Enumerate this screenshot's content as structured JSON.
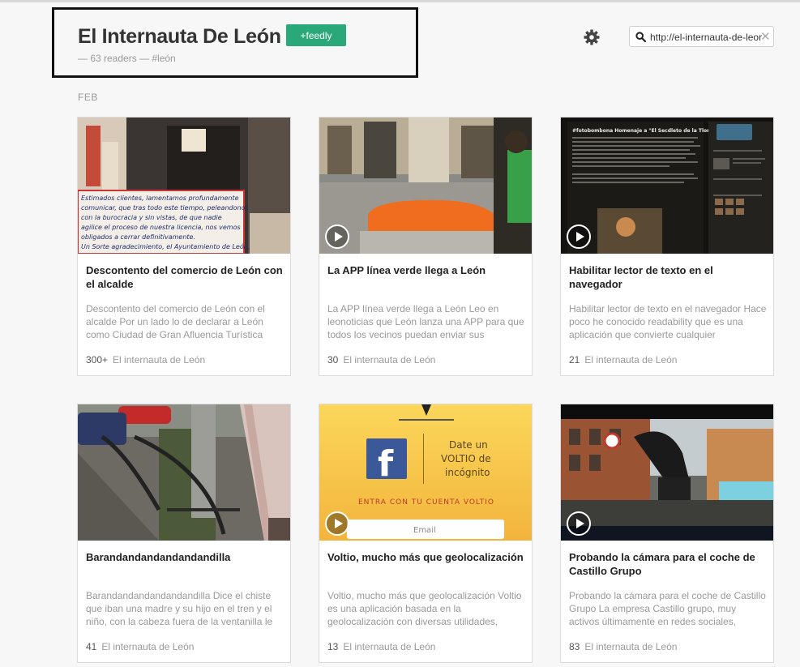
{
  "header": {
    "title": "El Internauta De León",
    "follow_label": "+feedly",
    "subline": "— 63 readers — #león"
  },
  "toolbar": {
    "settings_icon": "gear-icon",
    "search_value": "http://el-internauta-de-leon",
    "search_icon": "search-icon",
    "clear_icon": "close-icon"
  },
  "month_label": "FEB",
  "cards": [
    {
      "title": "Descontento del comercio de León con el alcalde",
      "summary": "Descontento del comercio de León con el alcalde Por un lado lo de declarar a León como Ciudad de Gran Afluencia Turística",
      "count": "300+",
      "source": "El internauta de León",
      "has_play": false
    },
    {
      "title": "La APP línea verde llega a León",
      "summary": "La APP línea verde llega a León Leo en leonoticias que León lanza una APP para que todos los vecinos puedan enviar sus",
      "count": "30",
      "source": "El internauta de León",
      "has_play": true
    },
    {
      "title": "Habilitar lector de texto en el navegador",
      "summary": "Habilitar lector de texto en el navegador Hace poco he conocido readability que es una aplicación que convierte cualquier",
      "count": "21",
      "source": "El internauta de León",
      "has_play": true
    },
    {
      "title": "Barandandandandandandilla",
      "summary": "Barandandandandandandilla Dice el chiste que iban una madre y su hijo en el tren y el niño, con la cabeza fuera de la ventanilla le",
      "count": "41",
      "source": "El internauta de León",
      "has_play": false
    },
    {
      "title": "Voltio, mucho más que geolocalización",
      "summary": "Voltio, mucho más que geolocalización Voltio es una aplicación basada en la geolocalización con diversas utilidades,",
      "count": "13",
      "source": "El internauta de León",
      "has_play": true
    },
    {
      "title": "Probando la cámara para el coche de Castillo Grupo",
      "summary": "Probando la cámara para el coche de Castillo Grupo La empresa Castillo grupo, muy activos últimamente en redes sociales,",
      "count": "83",
      "source": "El internauta de León",
      "has_play": true
    }
  ],
  "thumb_texts": {
    "sign_lines": [
      "Estimados clientes, lamentamos profundamente",
      "comunicar, que tras todo este tiempo, peleandonos",
      "con la burocracia y sin vistas, de que nadie",
      "agilice el proceso de nuestra licencia, nos vemos",
      "obligados a cerrar definitivamente.",
      "Un Sorte agradecimiento, el Ayuntamiento de León,"
    ],
    "voltio_line1": "Date un",
    "voltio_line2": "VOLTIO de",
    "voltio_line3": "incógnito",
    "voltio_cta": "ENTRA CON TU CUENTA VOLTIO",
    "voltio_email": "Email",
    "blog_heading": "#fotobombona Homenaje a \"El Secdleto de la Tlompeta\""
  }
}
